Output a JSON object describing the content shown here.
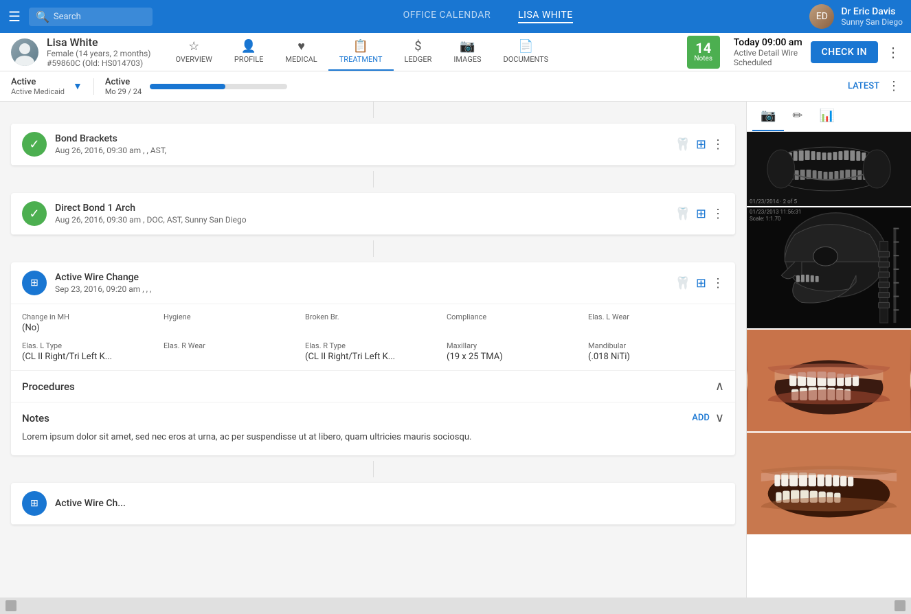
{
  "topNav": {
    "searchPlaceholder": "Search",
    "tabs": [
      {
        "label": "OFFICE CALENDAR",
        "active": false
      },
      {
        "label": "LISA WHITE",
        "active": true
      }
    ],
    "user": {
      "name": "Dr Eric Davis",
      "location": "Sunny San Diego"
    }
  },
  "patient": {
    "name": "Lisa White",
    "demographics": "Female (14 years, 2 months)",
    "id": "#59860C (Old: HS014703)",
    "navItems": [
      {
        "label": "OVERVIEW",
        "icon": "★",
        "active": false
      },
      {
        "label": "PROFILE",
        "icon": "👤",
        "active": false
      },
      {
        "label": "MEDICAL",
        "icon": "♥",
        "active": false
      },
      {
        "label": "TREATMENT",
        "icon": "📋",
        "active": true
      },
      {
        "label": "LEDGER",
        "icon": "$",
        "active": false
      },
      {
        "label": "IMAGES",
        "icon": "📷",
        "active": false
      },
      {
        "label": "DOCUMENTS",
        "icon": "📄",
        "active": false
      }
    ],
    "notes": {
      "count": "14",
      "label": "Notes"
    },
    "appointment": {
      "time": "Today 09:00 am",
      "detail1": "Active Detail Wire",
      "detail2": "Scheduled"
    },
    "checkinLabel": "CHECK IN"
  },
  "subheader": {
    "status1": "Active",
    "statusSub1": "Active Medicaid",
    "status2": "Active",
    "moLabel": "Mo 29 / 24",
    "latestLabel": "LATEST"
  },
  "treatments": [
    {
      "id": "bond-brackets",
      "icon": "✓",
      "iconType": "green",
      "title": "Bond Brackets",
      "date": "Aug 26, 2016, 09:30 am , , AST,"
    },
    {
      "id": "direct-bond",
      "icon": "✓",
      "iconType": "green",
      "title": "Direct Bond 1 Arch",
      "date": "Aug 26, 2016, 09:30 am , DOC, AST, Sunny San Diego"
    },
    {
      "id": "active-wire",
      "icon": "⊞",
      "iconType": "blue",
      "title": "Active Wire Change",
      "date": "Sep 23, 2016, 09:20 am , , ,",
      "details1": {
        "labels": [
          "Change in MH",
          "Hygiene",
          "Broken Br.",
          "Compliance",
          "Elas. L Wear"
        ],
        "values": [
          "(No)",
          "",
          "",
          "",
          ""
        ]
      },
      "details2": {
        "labels": [
          "Elas. L Type",
          "Elas. R Wear",
          "Elas. R Type",
          "Maxillary",
          "Mandibular"
        ],
        "values": [
          "(CL II Right/Tri Left K...",
          "",
          "(CL II Right/Tri Left K...",
          "(19 x 25 TMA)",
          "(.018 NiTi)"
        ]
      },
      "procedures": {
        "label": "Procedures"
      },
      "notes": {
        "label": "Notes",
        "addLabel": "ADD",
        "text": "Lorem ipsum dolor sit amet, sed nec eros at urna, ac per suspendisse ut at libero, quam ultricies mauris sociosqu."
      }
    }
  ],
  "rightPanel": {
    "tabs": [
      {
        "icon": "📷",
        "active": true
      },
      {
        "icon": "✏",
        "active": false
      },
      {
        "icon": "📊",
        "active": false
      }
    ]
  }
}
